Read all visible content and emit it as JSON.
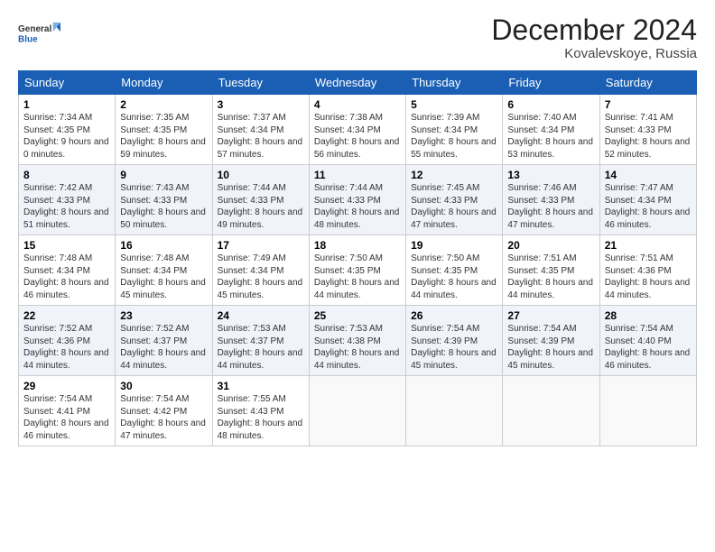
{
  "logo": {
    "line1": "General",
    "line2": "Blue"
  },
  "title": "December 2024",
  "location": "Kovalevskoye, Russia",
  "days_header": [
    "Sunday",
    "Monday",
    "Tuesday",
    "Wednesday",
    "Thursday",
    "Friday",
    "Saturday"
  ],
  "weeks": [
    [
      {
        "day": "1",
        "sunrise": "7:34 AM",
        "sunset": "4:35 PM",
        "daylight": "9 hours and 0 minutes."
      },
      {
        "day": "2",
        "sunrise": "7:35 AM",
        "sunset": "4:35 PM",
        "daylight": "8 hours and 59 minutes."
      },
      {
        "day": "3",
        "sunrise": "7:37 AM",
        "sunset": "4:34 PM",
        "daylight": "8 hours and 57 minutes."
      },
      {
        "day": "4",
        "sunrise": "7:38 AM",
        "sunset": "4:34 PM",
        "daylight": "8 hours and 56 minutes."
      },
      {
        "day": "5",
        "sunrise": "7:39 AM",
        "sunset": "4:34 PM",
        "daylight": "8 hours and 55 minutes."
      },
      {
        "day": "6",
        "sunrise": "7:40 AM",
        "sunset": "4:34 PM",
        "daylight": "8 hours and 53 minutes."
      },
      {
        "day": "7",
        "sunrise": "7:41 AM",
        "sunset": "4:33 PM",
        "daylight": "8 hours and 52 minutes."
      }
    ],
    [
      {
        "day": "8",
        "sunrise": "7:42 AM",
        "sunset": "4:33 PM",
        "daylight": "8 hours and 51 minutes."
      },
      {
        "day": "9",
        "sunrise": "7:43 AM",
        "sunset": "4:33 PM",
        "daylight": "8 hours and 50 minutes."
      },
      {
        "day": "10",
        "sunrise": "7:44 AM",
        "sunset": "4:33 PM",
        "daylight": "8 hours and 49 minutes."
      },
      {
        "day": "11",
        "sunrise": "7:44 AM",
        "sunset": "4:33 PM",
        "daylight": "8 hours and 48 minutes."
      },
      {
        "day": "12",
        "sunrise": "7:45 AM",
        "sunset": "4:33 PM",
        "daylight": "8 hours and 47 minutes."
      },
      {
        "day": "13",
        "sunrise": "7:46 AM",
        "sunset": "4:33 PM",
        "daylight": "8 hours and 47 minutes."
      },
      {
        "day": "14",
        "sunrise": "7:47 AM",
        "sunset": "4:34 PM",
        "daylight": "8 hours and 46 minutes."
      }
    ],
    [
      {
        "day": "15",
        "sunrise": "7:48 AM",
        "sunset": "4:34 PM",
        "daylight": "8 hours and 46 minutes."
      },
      {
        "day": "16",
        "sunrise": "7:48 AM",
        "sunset": "4:34 PM",
        "daylight": "8 hours and 45 minutes."
      },
      {
        "day": "17",
        "sunrise": "7:49 AM",
        "sunset": "4:34 PM",
        "daylight": "8 hours and 45 minutes."
      },
      {
        "day": "18",
        "sunrise": "7:50 AM",
        "sunset": "4:35 PM",
        "daylight": "8 hours and 44 minutes."
      },
      {
        "day": "19",
        "sunrise": "7:50 AM",
        "sunset": "4:35 PM",
        "daylight": "8 hours and 44 minutes."
      },
      {
        "day": "20",
        "sunrise": "7:51 AM",
        "sunset": "4:35 PM",
        "daylight": "8 hours and 44 minutes."
      },
      {
        "day": "21",
        "sunrise": "7:51 AM",
        "sunset": "4:36 PM",
        "daylight": "8 hours and 44 minutes."
      }
    ],
    [
      {
        "day": "22",
        "sunrise": "7:52 AM",
        "sunset": "4:36 PM",
        "daylight": "8 hours and 44 minutes."
      },
      {
        "day": "23",
        "sunrise": "7:52 AM",
        "sunset": "4:37 PM",
        "daylight": "8 hours and 44 minutes."
      },
      {
        "day": "24",
        "sunrise": "7:53 AM",
        "sunset": "4:37 PM",
        "daylight": "8 hours and 44 minutes."
      },
      {
        "day": "25",
        "sunrise": "7:53 AM",
        "sunset": "4:38 PM",
        "daylight": "8 hours and 44 minutes."
      },
      {
        "day": "26",
        "sunrise": "7:54 AM",
        "sunset": "4:39 PM",
        "daylight": "8 hours and 45 minutes."
      },
      {
        "day": "27",
        "sunrise": "7:54 AM",
        "sunset": "4:39 PM",
        "daylight": "8 hours and 45 minutes."
      },
      {
        "day": "28",
        "sunrise": "7:54 AM",
        "sunset": "4:40 PM",
        "daylight": "8 hours and 46 minutes."
      }
    ],
    [
      {
        "day": "29",
        "sunrise": "7:54 AM",
        "sunset": "4:41 PM",
        "daylight": "8 hours and 46 minutes."
      },
      {
        "day": "30",
        "sunrise": "7:54 AM",
        "sunset": "4:42 PM",
        "daylight": "8 hours and 47 minutes."
      },
      {
        "day": "31",
        "sunrise": "7:55 AM",
        "sunset": "4:43 PM",
        "daylight": "8 hours and 48 minutes."
      },
      null,
      null,
      null,
      null
    ]
  ],
  "labels": {
    "sunrise": "Sunrise: ",
    "sunset": "Sunset: ",
    "daylight": "Daylight: "
  }
}
